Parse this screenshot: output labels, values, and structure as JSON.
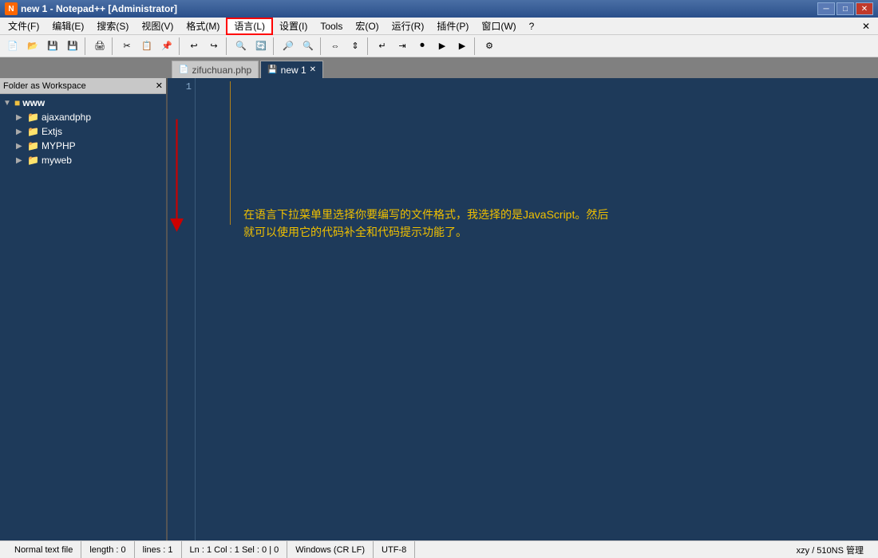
{
  "titleBar": {
    "icon": "N++",
    "title": "new 1 - Notepad++ [Administrator]",
    "minimize": "─",
    "maximize": "□",
    "close": "✕"
  },
  "menuBar": {
    "items": [
      {
        "label": "文件(F)"
      },
      {
        "label": "编辑(E)"
      },
      {
        "label": "搜索(S)"
      },
      {
        "label": "视图(V)"
      },
      {
        "label": "格式(M)"
      },
      {
        "label": "语言(L)",
        "highlighted": true
      },
      {
        "label": "设置(I)"
      },
      {
        "label": "Tools"
      },
      {
        "label": "宏(O)"
      },
      {
        "label": "运行(R)"
      },
      {
        "label": "插件(P)"
      },
      {
        "label": "窗口(W)"
      },
      {
        "label": "?"
      }
    ],
    "closeX": "✕"
  },
  "tabs": [
    {
      "label": "zifuchuan.php",
      "active": false,
      "icon": "📄"
    },
    {
      "label": "new 1",
      "active": true,
      "icon": "💾"
    }
  ],
  "sidebar": {
    "title": "Folder as Workspace",
    "root": {
      "label": "www",
      "expanded": true,
      "children": [
        {
          "label": "ajaxandphp",
          "expanded": false
        },
        {
          "label": "Extjs",
          "expanded": false
        },
        {
          "label": "MYPHP",
          "expanded": false
        },
        {
          "label": "myweb",
          "expanded": false
        }
      ]
    }
  },
  "editor": {
    "lineNumbers": [
      "1"
    ],
    "annotation": {
      "line1": "在语言下拉菜单里选择你要编写的文件格式，我选择的是JavaScript。然后",
      "line2": "就可以使用它的代码补全和代码提示功能了。"
    }
  },
  "statusBar": {
    "fileType": "Normal text file",
    "length": "length : 0",
    "lines": "lines : 1",
    "position": "Ln : 1   Col : 1   Sel : 0 | 0",
    "lineEnding": "Windows (CR LF)",
    "encoding": "UTF-8",
    "user": "xzy / 510NS 管理"
  },
  "colors": {
    "editorBg": "#1e3a5a",
    "sidebarBg": "#1e3a5a",
    "annotationColor": "#f0c000",
    "accent": "#f0a000"
  }
}
